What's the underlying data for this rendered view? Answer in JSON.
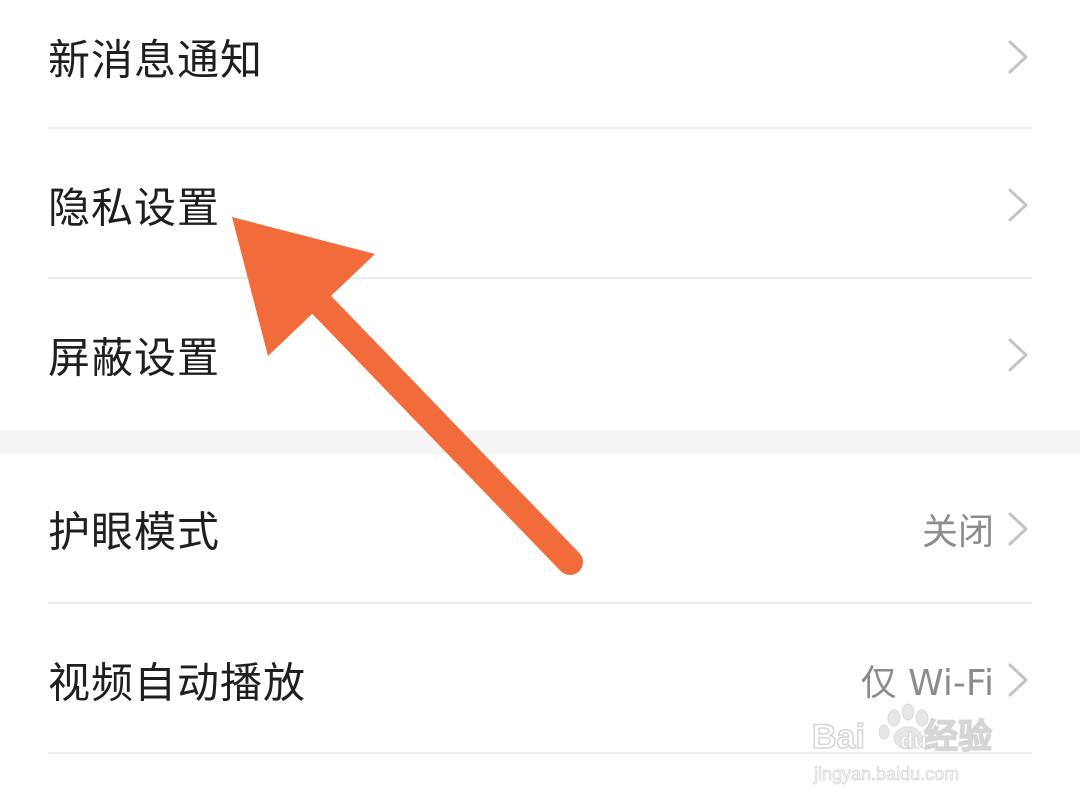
{
  "settings": {
    "section1": [
      {
        "label": "新消息通知"
      },
      {
        "label": "隐私设置"
      },
      {
        "label": "屏蔽设置"
      }
    ],
    "section2": [
      {
        "label": "护眼模式",
        "value": "关闭"
      },
      {
        "label": "视频自动播放",
        "value": "仅 Wi-Fi"
      }
    ]
  },
  "overlay": {
    "annotation_color": "#F26B3A",
    "watermark_text": "Bai du 经验",
    "watermark_url": "jingyan.baidu.com"
  },
  "icons": {
    "row_chevron": "chevron-right-icon",
    "annotation": "arrow-annotation-icon"
  }
}
